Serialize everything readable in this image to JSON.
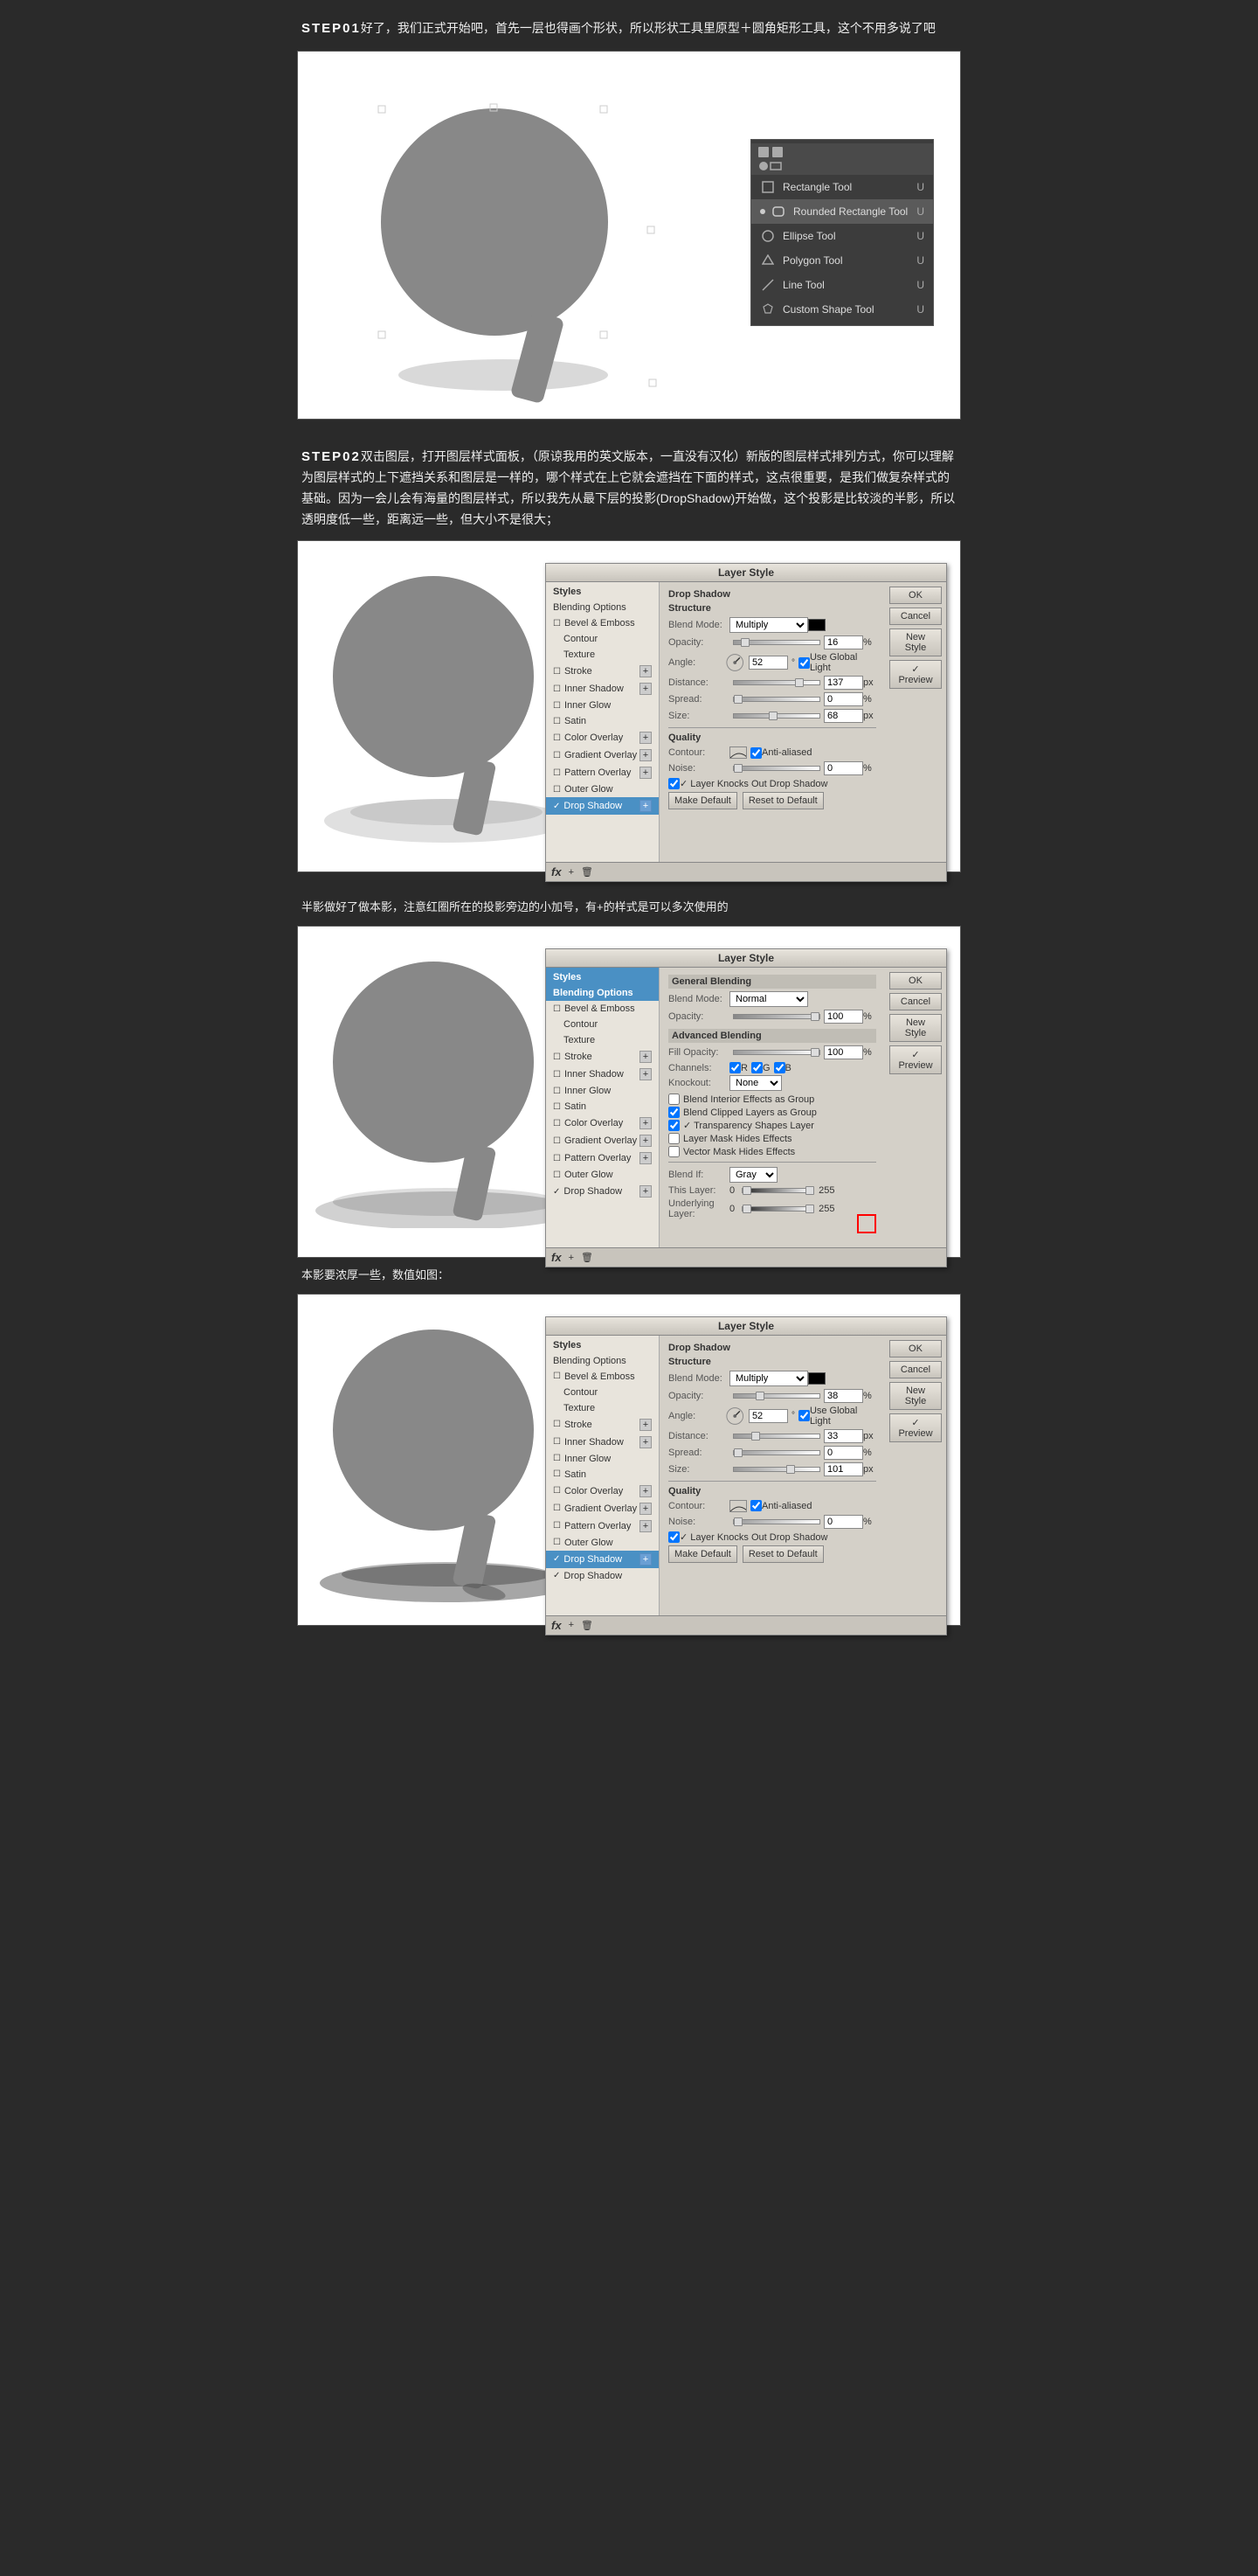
{
  "steps": [
    {
      "id": "step01",
      "number": "STEP01",
      "text": "好了，我们正式开始吧，首先一层也得画个形状，所以形状工具里原型＋圆角矩形工具，这个不用多说了吧",
      "tools": [
        {
          "name": "Rectangle Tool",
          "shortcut": "U",
          "selected": false
        },
        {
          "name": "Rounded Rectangle Tool",
          "shortcut": "U",
          "selected": true
        },
        {
          "name": "Ellipse Tool",
          "shortcut": "U",
          "selected": false
        },
        {
          "name": "Polygon Tool",
          "shortcut": "U",
          "selected": false
        },
        {
          "name": "Line Tool",
          "shortcut": "U",
          "selected": false
        },
        {
          "name": "Custom Shape Tool",
          "shortcut": "U",
          "selected": false
        }
      ]
    },
    {
      "id": "step02",
      "number": "STEP02",
      "text": "双击图层，打开图层样式面板，（原谅我用的英文版本，一直没有汉化）新版的图层样式排列方式，你可以理解为图层样式的上下遮挡关系和图层是一样的，哪个样式在上它就会遮挡在下面的样式，这点很重要，是我们做复杂样式的基础。因为一会儿会有海量的图层样式，所以我先从最下层的投影(DropShadow)开始做，这个投影是比较淡的半影，所以透明度低一些，距离远一些，但大小不是很大；"
    }
  ],
  "panel": {
    "title": "Layer Style",
    "ok_label": "OK",
    "cancel_label": "Cancel",
    "new_style_label": "New Style",
    "preview_label": "✓ Preview"
  },
  "drop_shadow_panel1": {
    "title": "Drop Shadow",
    "structure_label": "Structure",
    "blend_mode_label": "Blend Mode:",
    "blend_mode_value": "Multiply",
    "opacity_label": "Opacity:",
    "opacity_value": "16",
    "angle_label": "Angle:",
    "angle_value": "52",
    "use_global_light": "Use Global Light",
    "distance_label": "Distance:",
    "distance_value": "137",
    "spread_label": "Spread:",
    "spread_value": "0",
    "size_label": "Size:",
    "size_value": "68",
    "quality_label": "Quality",
    "contour_label": "Contour:",
    "anti_aliased": "Anti-aliased",
    "noise_label": "Noise:",
    "noise_value": "0",
    "layer_knocks_out": "✓ Layer Knocks Out Drop Shadow",
    "make_default": "Make Default",
    "reset_to_default": "Reset to Default"
  },
  "styles_list": {
    "header1": "Styles",
    "header2": "Blending Options",
    "items": [
      {
        "label": "Bevel & Emboss",
        "checked": false
      },
      {
        "label": "Contour",
        "checked": false
      },
      {
        "label": "Texture",
        "checked": false
      },
      {
        "label": "Stroke",
        "checked": false,
        "has_plus": true
      },
      {
        "label": "Inner Shadow",
        "checked": false,
        "has_plus": true
      },
      {
        "label": "Inner Glow",
        "checked": false
      },
      {
        "label": "Satin",
        "checked": false
      },
      {
        "label": "Color Overlay",
        "checked": false,
        "has_plus": true
      },
      {
        "label": "Gradient Overlay",
        "checked": false,
        "has_plus": true
      },
      {
        "label": "Pattern Overlay",
        "checked": false,
        "has_plus": true
      },
      {
        "label": "Outer Glow",
        "checked": false
      },
      {
        "label": "Drop Shadow",
        "checked": true,
        "has_plus": true,
        "selected": true
      }
    ]
  },
  "blending_panel": {
    "general_blend_label": "General Blending",
    "blend_mode_label": "Blend Mode:",
    "blend_mode_value": "Normal",
    "opacity_label": "Opacity:",
    "opacity_value": "100",
    "advanced_label": "Advanced Blending",
    "fill_opacity_label": "Fill Opacity:",
    "fill_opacity_value": "100",
    "channels_label": "Channels:",
    "r_check": "✓R",
    "g_check": "✓G",
    "b_check": "✓B",
    "knockout_label": "Knockout:",
    "knockout_value": "None",
    "blend_interior": "Blend Interior Effects as Group",
    "blend_clipped": "Blend Clipped Layers as Group",
    "transparency": "✓ Transparency Shapes Layer",
    "layer_mask": "Layer Mask Hides Effects",
    "vector_mask": "Vector Mask Hides Effects",
    "blend_if_label": "Blend If:",
    "blend_if_value": "Gray",
    "this_layer_label": "This Layer:",
    "this_layer_start": "0",
    "this_layer_end": "255",
    "underlying_label": "Underlying Layer:",
    "underlying_start": "0",
    "underlying_end": "255"
  },
  "drop_shadow_panel2": {
    "blend_mode_value": "Multiply",
    "opacity_value": "38",
    "angle_value": "52",
    "use_global_light": "Use Global Light",
    "distance_value": "33",
    "spread_value": "0",
    "size_value": "101",
    "noise_value": "0",
    "layer_knocks_out": "✓ Layer Knocks Out Drop Shadow",
    "make_default": "Make Default",
    "reset_to_default": "Reset to Default"
  },
  "sub_texts": {
    "shadow_note": "半影做好了做本影，注意红圈所在的投影旁边的小加号，有+的样式是可以多次使用的",
    "dense_shadow_note": "本影要浓厚一些，数值如图："
  }
}
